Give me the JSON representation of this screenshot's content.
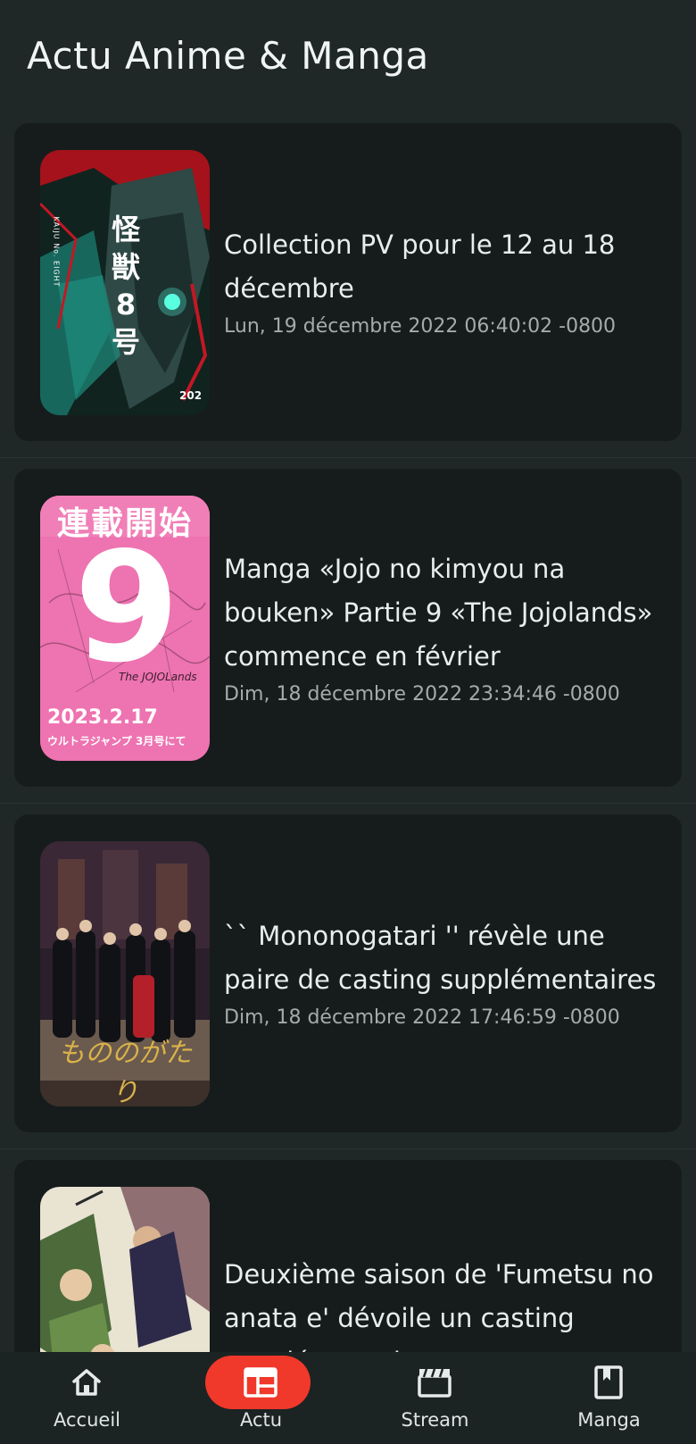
{
  "header": {
    "title": "Actu Anime & Manga"
  },
  "articles": [
    {
      "title": "Collection PV pour le 12 au 18 décembre",
      "date": "Lun, 19 décembre 2022 06:40:02 -0800",
      "poster_text": [
        "怪",
        "獣",
        "8",
        "号"
      ],
      "poster_caption": "KAIJU No. EIGHT",
      "poster_corner": "202"
    },
    {
      "title": "Manga «Jojo no kimyou na bouken» Partie 9 «The Jojolands» commence en février",
      "date": "Dim, 18 décembre 2022 23:34:46 -0800",
      "poster_banner": "連載開始",
      "poster_number": "9",
      "poster_subtitle": "The JOJOLands",
      "poster_date": "2023.2.17",
      "poster_footer": "ウルトラジャンプ 3月号にて"
    },
    {
      "title": "`` Mononogatari '' révèle une paire de casting supplémentaires",
      "date": "Dim, 18 décembre 2022 17:46:59 -0800",
      "poster_logo": "もののがたり"
    },
    {
      "title": "Deuxième saison de 'Fumetsu no anata e' dévoile un casting supplémentaire",
      "date": ""
    }
  ],
  "nav": {
    "items": [
      {
        "label": "Accueil",
        "icon": "home-icon",
        "active": false
      },
      {
        "label": "Actu",
        "icon": "news-icon",
        "active": true
      },
      {
        "label": "Stream",
        "icon": "clapperboard-icon",
        "active": false
      },
      {
        "label": "Manga",
        "icon": "book-icon",
        "active": false
      }
    ],
    "accent": "#f0382b"
  },
  "colors": {
    "background": "#1f2727",
    "card": "#161c1c",
    "nav": "#1b2323"
  }
}
